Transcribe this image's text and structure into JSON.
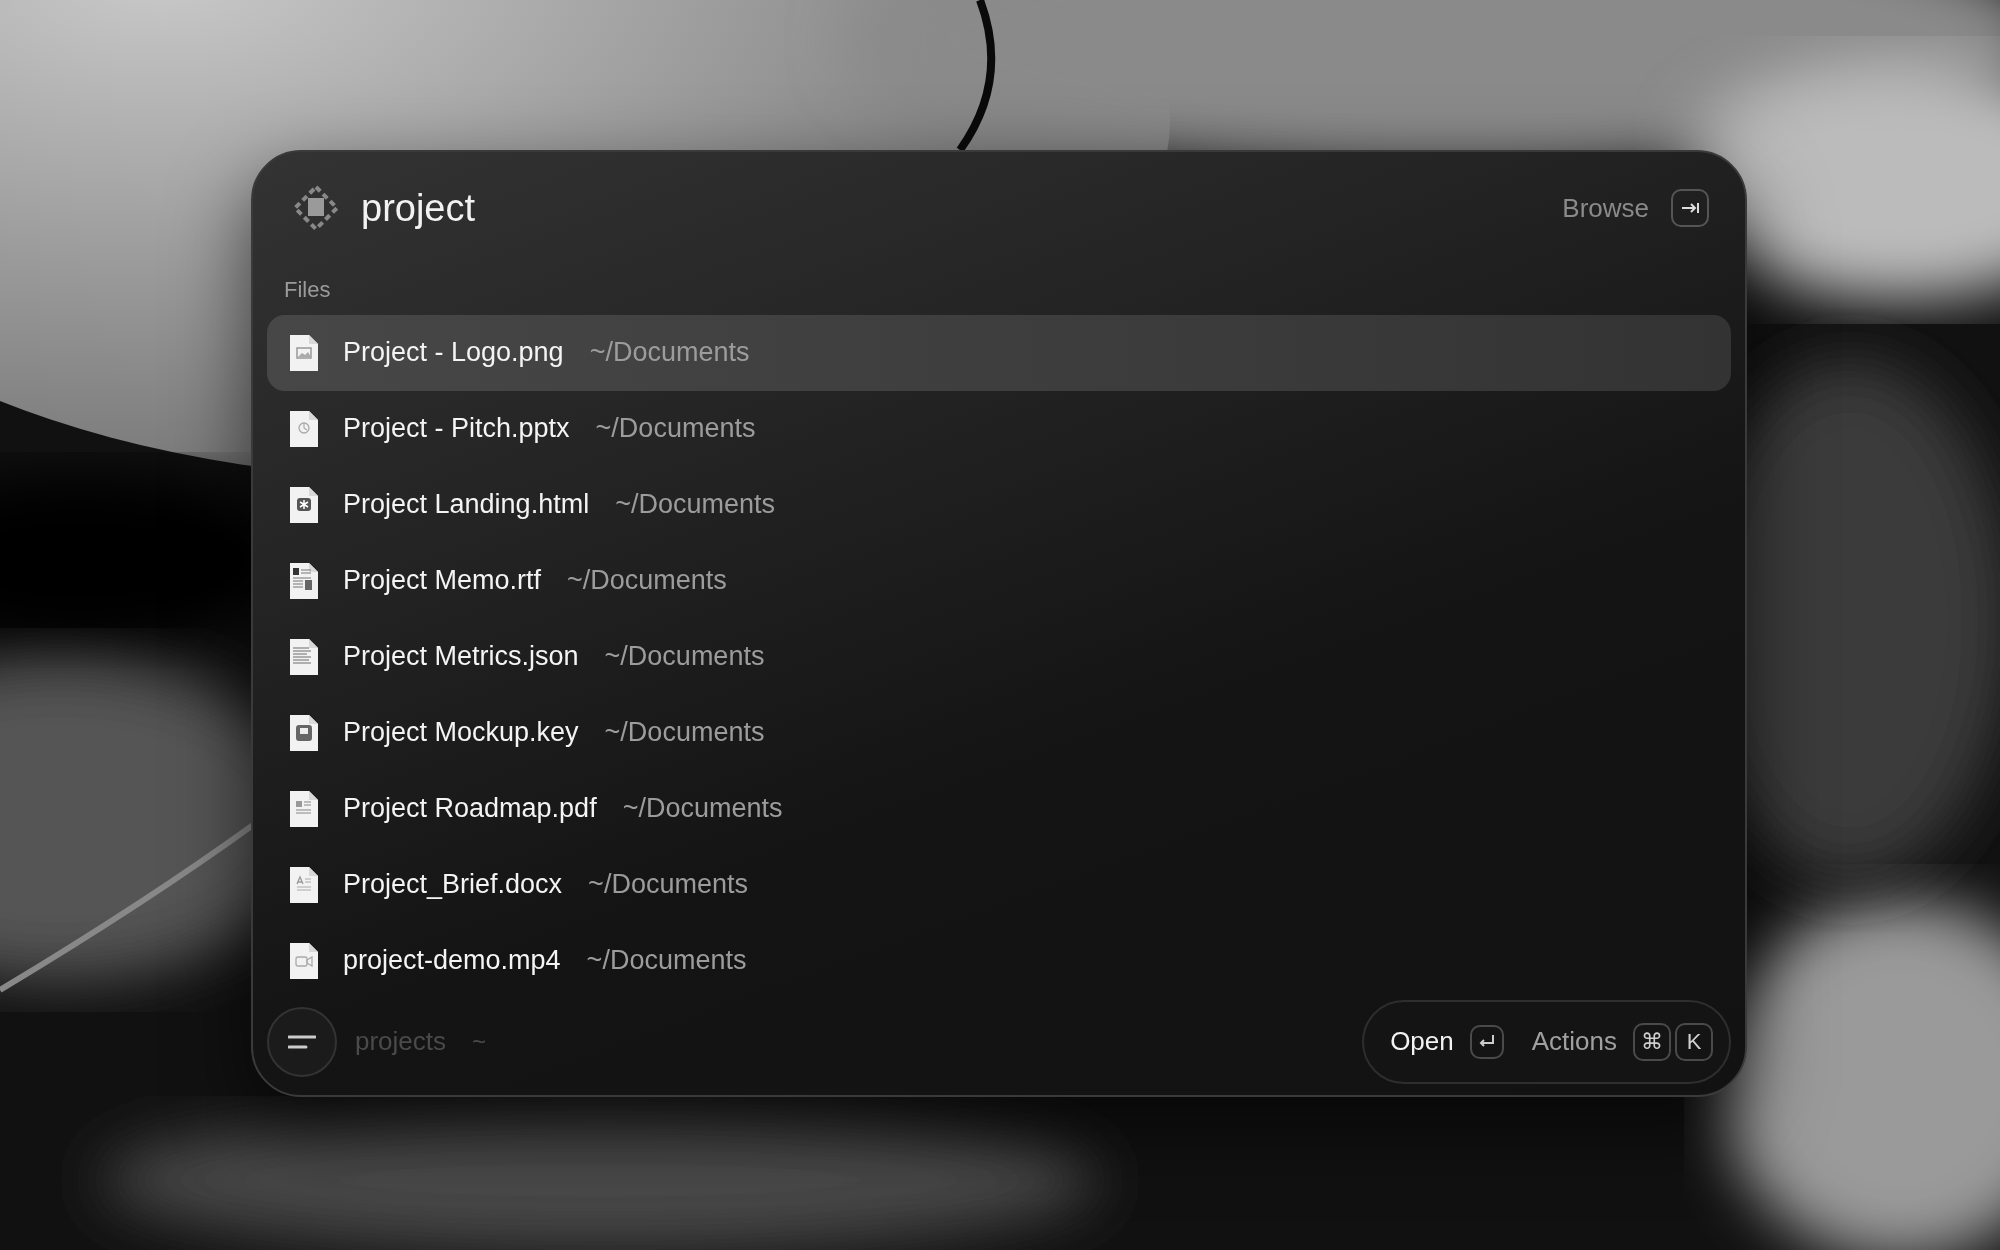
{
  "search": {
    "query": "project",
    "browse_label": "Browse"
  },
  "section": "Files",
  "files": [
    {
      "name": "Project - Logo.png",
      "path": "~/Documents",
      "selected": true
    },
    {
      "name": "Project - Pitch.pptx",
      "path": "~/Documents",
      "kind": "presentation",
      "selected": false
    },
    {
      "name": "Project Landing.html",
      "path": "~/Documents",
      "kind": "html",
      "selected": false
    },
    {
      "name": "Project Memo.rtf",
      "path": "~/Documents",
      "kind": "richtext",
      "selected": false
    },
    {
      "name": "Project Metrics.json",
      "path": "~/Documents",
      "kind": "text",
      "selected": false
    },
    {
      "name": "Project Mockup.key",
      "path": "~/Documents",
      "kind": "keynote",
      "selected": false
    },
    {
      "name": "Project Roadmap.pdf",
      "path": "~/Documents",
      "kind": "pdf",
      "selected": false
    },
    {
      "name": "Project_Brief.docx",
      "path": "~/Documents",
      "kind": "word",
      "selected": false
    },
    {
      "name": "project-demo.mp4",
      "path": "~/Documents",
      "kind": "video",
      "selected": false
    }
  ],
  "footer": {
    "context": "projects",
    "context_path": "~",
    "actions": [
      {
        "label": "Open",
        "primary": true,
        "keys": [
          {
            "kind": "return"
          }
        ]
      },
      {
        "label": "Actions",
        "primary": false,
        "keys": [
          {
            "kind": "text",
            "text": "⌘"
          },
          {
            "kind": "text",
            "text": "K"
          }
        ]
      }
    ]
  }
}
